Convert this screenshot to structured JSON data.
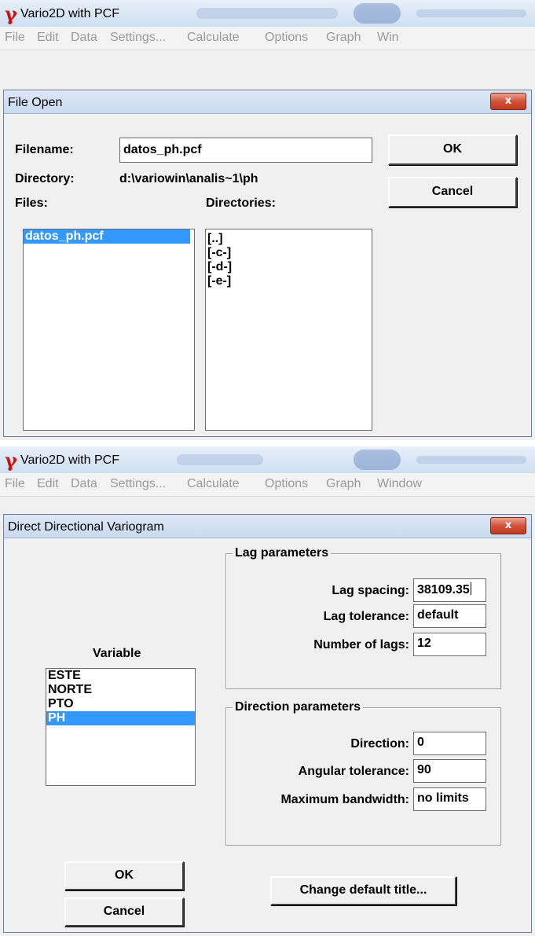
{
  "app": {
    "title": "Vario2D with PCF",
    "menus_top": [
      "File",
      "Edit",
      "Data",
      "Settings...",
      "Calculate",
      "Options",
      "Graph",
      "Win"
    ],
    "menus_bottom": [
      "File",
      "Edit",
      "Data",
      "Settings...",
      "Calculate",
      "Options",
      "Graph",
      "Window"
    ]
  },
  "file_open": {
    "title": "File Open",
    "close_glyph": "x",
    "filename_label": "Filename:",
    "filename_value": "datos_ph.pcf",
    "directory_label": "Directory:",
    "directory_value": "d:\\variowin\\analis~1\\ph",
    "files_label": "Files:",
    "directories_label": "Directories:",
    "files": [
      "datos_ph.pcf"
    ],
    "directories": [
      "[..]",
      "[-c-]",
      "[-d-]",
      "[-e-]"
    ],
    "ok_label": "OK",
    "cancel_label": "Cancel"
  },
  "variogram": {
    "title": "Direct Directional Variogram",
    "close_glyph": "x",
    "variable_label": "Variable",
    "variables": [
      "ESTE",
      "NORTE",
      "PTO",
      "PH"
    ],
    "selected_variable": "PH",
    "lag_group_label": "Lag parameters",
    "lag_spacing_label": "Lag spacing:",
    "lag_spacing_value": "38109.35",
    "lag_tolerance_label": "Lag tolerance:",
    "lag_tolerance_value": "default",
    "num_lags_label": "Number of lags:",
    "num_lags_value": "12",
    "dir_group_label": "Direction parameters",
    "direction_label": "Direction:",
    "direction_value": "0",
    "angular_tolerance_label": "Angular tolerance:",
    "angular_tolerance_value": "90",
    "max_bandwidth_label": "Maximum bandwidth:",
    "max_bandwidth_value": "no limits",
    "ok_label": "OK",
    "cancel_label": "Cancel",
    "change_title_label": "Change default title..."
  },
  "colors": {
    "selection": "#3399ff",
    "close_button": "#c0391f",
    "gamma_icon": "#cc1111",
    "menu_disabled": "#9a9a9a"
  }
}
